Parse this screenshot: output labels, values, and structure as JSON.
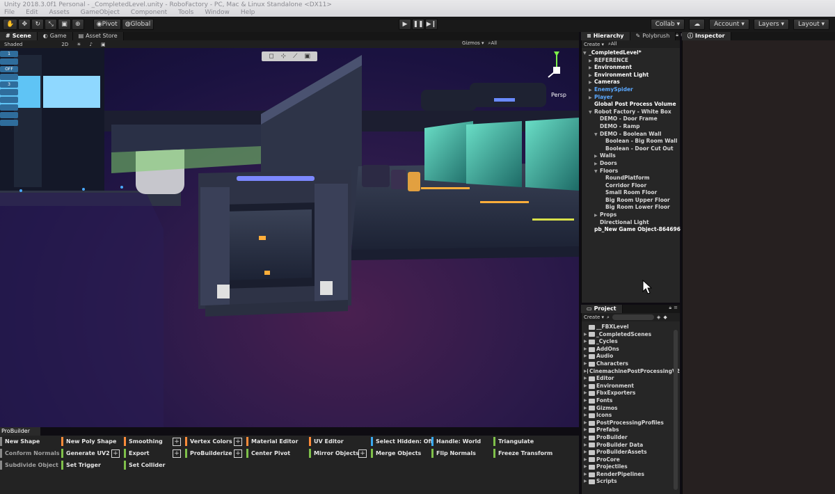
{
  "os_bar": {
    "title": "Unity 2018.3.0f1 Personal - _CompletedLevel.unity - RoboFactory - PC, Mac & Linux Standalone <DX11>",
    "menu": [
      "File",
      "Edit",
      "Assets",
      "GameObject",
      "Component",
      "Tools",
      "Window",
      "Help"
    ]
  },
  "toolbar": {
    "pivot": "Pivot",
    "global": "Global",
    "collab": "Collab ▾",
    "account": "Account ▾",
    "layers": "Layers ▾",
    "layout": "Layout ▾"
  },
  "scene": {
    "tabs": [
      "Scene",
      "Game",
      "Asset Store"
    ],
    "shading": "Shaded",
    "mode_2d": "2D",
    "gizmos": "Gizmos ▾",
    "search_all": "All",
    "persp": "Persp",
    "left_tools": [
      "1",
      "",
      "OFF",
      "",
      "3",
      "",
      "",
      "",
      "",
      ""
    ]
  },
  "probuilder": {
    "tab": "ProBuilder",
    "columns": [
      [
        {
          "label": "New Shape",
          "color": "#ffffff"
        },
        {
          "label": "Conform Normals",
          "color": "#aaaaaa"
        },
        {
          "label": "Subdivide Object",
          "color": "#aaaaaa"
        }
      ],
      [
        {
          "label": "New Poly Shape",
          "color": "#ff8c3a"
        },
        {
          "label": "Generate UV2",
          "color": "#7fc04a"
        },
        {
          "label": "Set Trigger",
          "color": "#7fc04a"
        }
      ],
      [
        {
          "label": "Smoothing",
          "color": "#ff8c3a"
        },
        {
          "label": "Export",
          "color": "#7fc04a"
        },
        {
          "label": "Set Collider",
          "color": "#7fc04a"
        }
      ],
      [
        {
          "label": "Vertex Colors",
          "color": "#ff8c3a"
        },
        {
          "label": "ProBuilderize",
          "color": "#7fc04a"
        }
      ],
      [
        {
          "label": "Material Editor",
          "color": "#ff8c3a"
        },
        {
          "label": "Center Pivot",
          "color": "#7fc04a"
        }
      ],
      [
        {
          "label": "UV Editor",
          "color": "#ff8c3a"
        },
        {
          "label": "Mirror Objects",
          "color": "#7fc04a"
        }
      ],
      [
        {
          "label": "Select Hidden: Off",
          "color": "#3aaaf0"
        },
        {
          "label": "Merge Objects",
          "color": "#7fc04a"
        }
      ],
      [
        {
          "label": "Handle: World",
          "color": "#3aaaf0"
        },
        {
          "label": "Flip Normals",
          "color": "#7fc04a"
        }
      ],
      [
        {
          "label": "Triangulate",
          "color": "#7fc04a"
        },
        {
          "label": "Freeze Transform",
          "color": "#7fc04a"
        }
      ]
    ]
  },
  "hierarchy": {
    "tabs": [
      "Hierarchy",
      "Polybrush"
    ],
    "create": "Create ▾",
    "search_all": "All",
    "items": [
      {
        "label": "_CompletedLevel*",
        "arrow": "▼",
        "color": "white"
      },
      {
        "label": "REFERENCE",
        "arrow": "▶",
        "color": "normal"
      },
      {
        "label": "Environment",
        "arrow": "▶",
        "color": "white"
      },
      {
        "label": "Environment Light",
        "arrow": "▶",
        "color": "white"
      },
      {
        "label": "Cameras",
        "arrow": "▶",
        "color": "white"
      },
      {
        "label": "EnemySpider",
        "arrow": "▶",
        "color": "blue"
      },
      {
        "label": "Player",
        "arrow": "▶",
        "color": "blue"
      },
      {
        "label": "Global Post Process Volume",
        "arrow": "",
        "color": "white"
      },
      {
        "label": "Robot Factory - White Box",
        "arrow": "▼",
        "color": "normal"
      },
      {
        "label": "DEMO - Door Frame",
        "arrow": "",
        "color": "normal"
      },
      {
        "label": "DEMO - Ramp",
        "arrow": "",
        "color": "normal"
      },
      {
        "label": "DEMO - Boolean Wall",
        "arrow": "▼",
        "color": "normal"
      },
      {
        "label": "Boolean - Big Room Wall",
        "arrow": "",
        "color": "normal"
      },
      {
        "label": "Boolean - Door Cut Out",
        "arrow": "",
        "color": "normal"
      },
      {
        "label": "Walls",
        "arrow": "▶",
        "color": "normal"
      },
      {
        "label": "Doors",
        "arrow": "▶",
        "color": "normal"
      },
      {
        "label": "Floors",
        "arrow": "▼",
        "color": "normal"
      },
      {
        "label": "RoundPlatform",
        "arrow": "",
        "color": "normal"
      },
      {
        "label": "Corridor Floor",
        "arrow": "",
        "color": "normal"
      },
      {
        "label": "Small Room Floor",
        "arrow": "",
        "color": "normal"
      },
      {
        "label": "Big Room Upper Floor",
        "arrow": "",
        "color": "normal"
      },
      {
        "label": "Big Room Lower Floor",
        "arrow": "",
        "color": "normal"
      },
      {
        "label": "Props",
        "arrow": "▶",
        "color": "normal"
      },
      {
        "label": "Directional Light",
        "arrow": "",
        "color": "normal"
      },
      {
        "label": "pb_New Game Object-864696",
        "arrow": "",
        "color": "white"
      }
    ]
  },
  "inspector": {
    "tab": "Inspector"
  },
  "project": {
    "tab": "Project",
    "create": "Create ▾",
    "folders": [
      "__FBXLevel",
      "_CompletedScenes",
      "_Cycles",
      "AddOns",
      "Audio",
      "Characters",
      "CinemachinePostProcessingV2",
      "Editor",
      "Environment",
      "FbxExporters",
      "Fonts",
      "Gizmos",
      "Icons",
      "PostProcessingProfiles",
      "Prefabs",
      "ProBuilder",
      "ProBuilder Data",
      "ProBuilderAssets",
      "ProCore",
      "Projectiles",
      "RenderPipelines",
      "Scripts"
    ]
  }
}
